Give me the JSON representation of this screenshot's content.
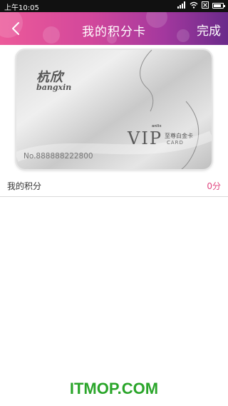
{
  "status_bar": {
    "time": "上午10:05",
    "icons": [
      "signal-icon",
      "wifi-icon",
      "notification-mute-icon",
      "battery-icon"
    ],
    "battery_level_pct": 85
  },
  "header": {
    "title": "我的积分卡",
    "done_label": "完成",
    "back_icon": "chevron-left-icon",
    "gradient_colors": [
      "#ec5a9a",
      "#a3389e",
      "#6a2a8a"
    ]
  },
  "card": {
    "brand_cn": "杭欣",
    "brand_en": "bangxin",
    "vip_text": "VIP",
    "vip_small": "anlix",
    "tier_text": "至尊白金卡",
    "card_word": "CARD",
    "card_number": "No.888888222800"
  },
  "points": {
    "label": "我的积分",
    "value": "0分",
    "value_color": "#e0457f"
  },
  "watermark": "ITMOP.COM",
  "watermark_color": "#2aa52a"
}
